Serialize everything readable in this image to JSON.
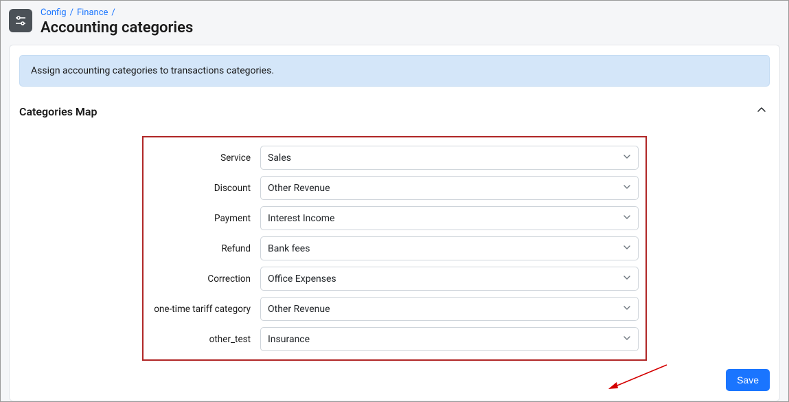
{
  "breadcrumb": {
    "items": [
      "Config",
      "Finance"
    ]
  },
  "page_title": "Accounting categories",
  "info_text": "Assign accounting categories to transactions categories.",
  "section": {
    "title": "Categories Map"
  },
  "fields": [
    {
      "label": "Service",
      "value": "Sales"
    },
    {
      "label": "Discount",
      "value": "Other Revenue"
    },
    {
      "label": "Payment",
      "value": "Interest Income"
    },
    {
      "label": "Refund",
      "value": "Bank fees"
    },
    {
      "label": "Correction",
      "value": "Office Expenses"
    },
    {
      "label": "one-time tariff category",
      "value": "Other Revenue"
    },
    {
      "label": "other_test",
      "value": "Insurance"
    }
  ],
  "buttons": {
    "save": "Save"
  }
}
